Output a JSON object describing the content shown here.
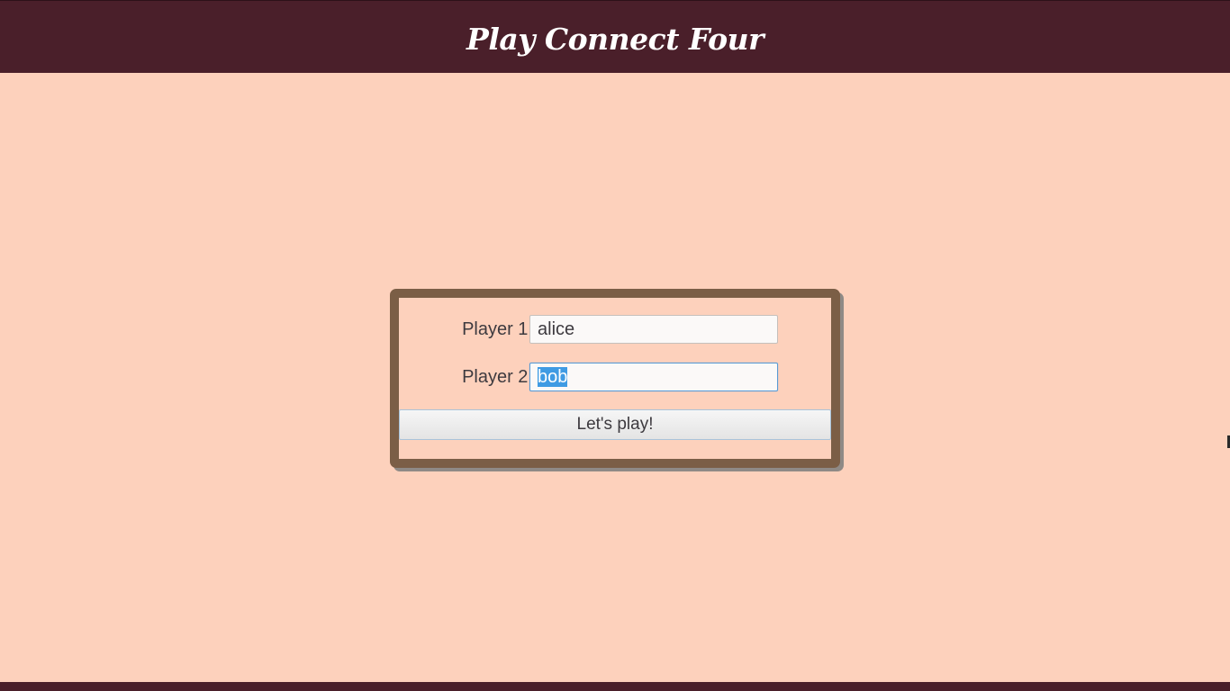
{
  "header": {
    "title": "Play Connect Four"
  },
  "form": {
    "player1": {
      "label": "Player 1:",
      "value": "alice"
    },
    "player2": {
      "label": "Player 2:",
      "value": "bob"
    },
    "submit_label": "Let's play!"
  },
  "colors": {
    "background": "#fdd1bc",
    "header": "#4a1f2a",
    "card_border": "#7b5e46",
    "selection": "#3f9be3"
  }
}
